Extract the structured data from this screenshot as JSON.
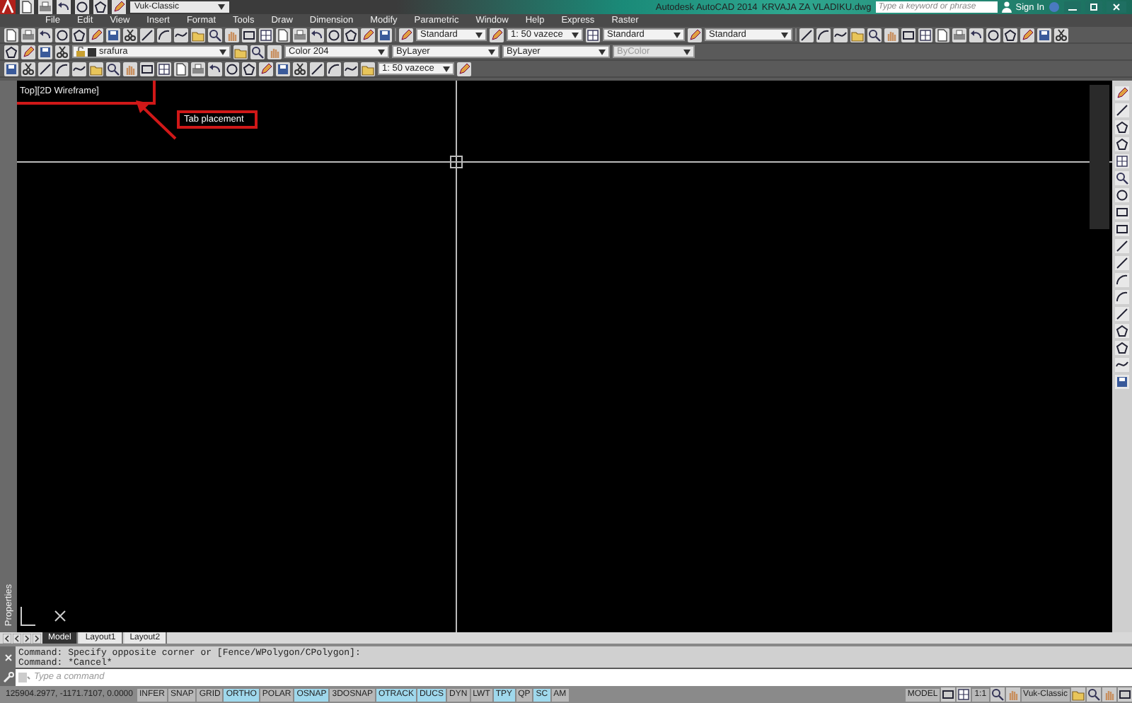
{
  "title_bar": {
    "workspace": "Vuk-Classic",
    "title": "Autodesk AutoCAD 2014",
    "file": "KRVAJA ZA VLADIKU.dwg",
    "search": {
      "placeholder": "Type a keyword or phrase"
    },
    "sign_in": "Sign In"
  },
  "menu": [
    "File",
    "Edit",
    "View",
    "Insert",
    "Format",
    "Tools",
    "Draw",
    "Dimension",
    "Modify",
    "Parametric",
    "Window",
    "Help",
    "Express",
    "Raster"
  ],
  "toolbar_1": {
    "dropdowns": [
      {
        "value": "Standard",
        "disabled": false
      },
      {
        "value": "1: 50 vazece",
        "disabled": false
      },
      {
        "value": "Standard",
        "disabled": false
      },
      {
        "value": "Standard",
        "disabled": false
      }
    ]
  },
  "toolbar_2": {
    "layer": "srafura",
    "dropdowns": [
      {
        "value": "Color 204",
        "disabled": false
      },
      {
        "value": "ByLayer",
        "disabled": false
      },
      {
        "value": "ByLayer",
        "disabled": false
      },
      {
        "value": "ByColor",
        "disabled": true
      }
    ]
  },
  "toolbar_3": {
    "dropdowns": [
      {
        "value": "1: 50 vazece",
        "disabled": false
      }
    ]
  },
  "viewport": {
    "label": "Top][2D Wireframe]",
    "annotation": "Tab placement"
  },
  "palette": {
    "label": "Properties"
  },
  "layout_tabs": [
    {
      "label": "Model",
      "selected": true
    },
    {
      "label": "Layout1",
      "selected": false
    },
    {
      "label": "Layout2",
      "selected": false
    }
  ],
  "command_history": [
    "Command: Specify opposite corner or [Fence/WPolygon/CPolygon]:",
    "Command: *Cancel*"
  ],
  "command_input": {
    "placeholder": "Type a command"
  },
  "status_bar": {
    "coordinates": "125904.2977, -1171.7107, 0.0000",
    "toggles": [
      {
        "label": "INFER",
        "on": false
      },
      {
        "label": "SNAP",
        "on": false
      },
      {
        "label": "GRID",
        "on": false
      },
      {
        "label": "ORTHO",
        "on": true
      },
      {
        "label": "POLAR",
        "on": false
      },
      {
        "label": "OSNAP",
        "on": true
      },
      {
        "label": "3DOSNAP",
        "on": false
      },
      {
        "label": "OTRACK",
        "on": true
      },
      {
        "label": "DUCS",
        "on": true
      },
      {
        "label": "DYN",
        "on": false
      },
      {
        "label": "LWT",
        "on": false
      },
      {
        "label": "TPY",
        "on": true
      },
      {
        "label": "QP",
        "on": false
      },
      {
        "label": "SC",
        "on": true
      },
      {
        "label": "AM",
        "on": false
      }
    ],
    "space": "MODEL",
    "scale": "1:1",
    "workspace": "Vuk-Classic"
  }
}
